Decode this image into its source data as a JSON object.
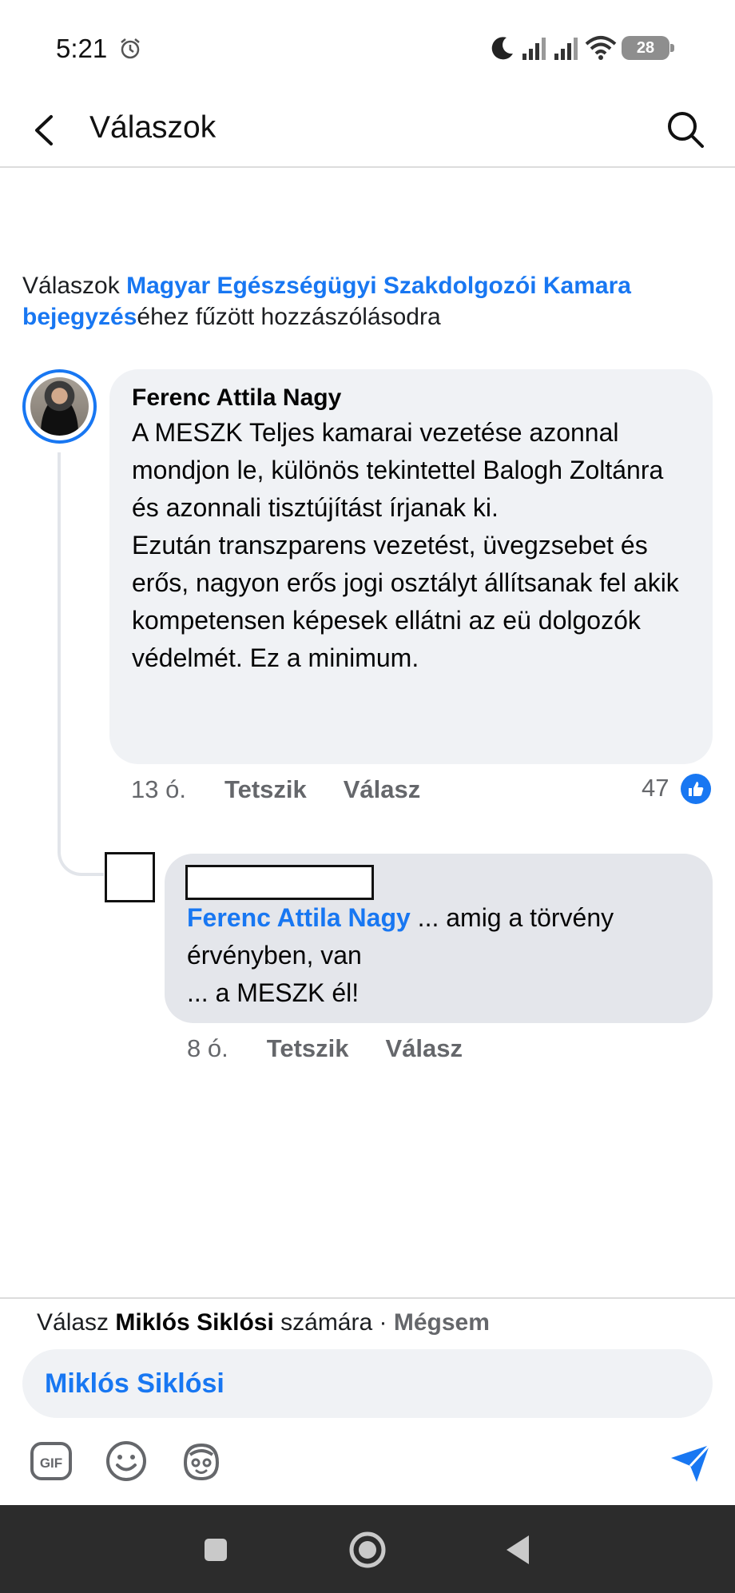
{
  "status_bar": {
    "time": "5:21",
    "battery": "28",
    "icons": [
      "alarm-icon",
      "moon-icon",
      "signal-icon",
      "signal-icon",
      "wifi-icon",
      "battery-icon"
    ]
  },
  "header": {
    "title": "Válaszok",
    "back_icon": "back-arrow-icon",
    "search_icon": "search-icon"
  },
  "context": {
    "prefix": "Válaszok ",
    "link": "Magyar Egészségügyi Szakdolgozói Kamara bejegyzés",
    "suffix": "éhez fűzött hozzászólásodra"
  },
  "comment": {
    "author": "Ferenc Attila Nagy",
    "text": "A MESZK Teljes kamarai vezetése azonnal mondjon le, különös tekintettel Balogh Zoltánra és azonnali tisztújítást írjanak ki.\nEzután transzparens vezetést, üvegzsebet és erős, nagyon erős jogi osztályt állítsanak fel akik kompetensen képesek ellátni az eü dolgozók védelmét. Ez a minimum.",
    "time": "13 ó.",
    "like_label": "Tetszik",
    "reply_label": "Válasz",
    "reaction_count": "47"
  },
  "reply": {
    "mention": "Ferenc Attila Nagy",
    "text": " ... amig a törvény érvényben, van\n... a MESZK él!",
    "time": "8 ó.",
    "like_label": "Tetszik",
    "reply_label": "Válasz"
  },
  "composer": {
    "reply_prefix": "Válasz ",
    "reply_target": "Miklós Siklósi",
    "reply_suffix": " számára · ",
    "cancel_label": "Mégsem",
    "input_mention": "Miklós Siklósi",
    "tools": [
      "gif-icon",
      "emoji-icon",
      "avatar-sticker-icon"
    ],
    "send_icon": "send-icon"
  },
  "colors": {
    "accent": "#1877f2",
    "bubble": "#f0f2f5",
    "reply_bubble": "#e4e6eb",
    "muted_text": "#65676b",
    "nav_bar": "#2c2c2c"
  }
}
